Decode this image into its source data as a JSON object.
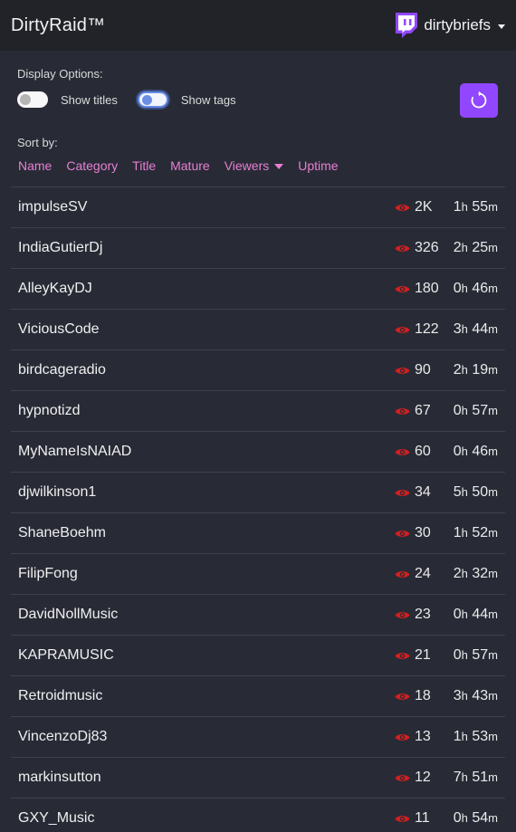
{
  "navbar": {
    "brand": "DirtyRaid™",
    "username": "dirtybriefs",
    "logo_icon": "twitch-logo-icon",
    "accent_color": "#9147ff"
  },
  "display_options": {
    "label": "Display Options:",
    "show_titles": {
      "label": "Show titles",
      "enabled": false
    },
    "show_tags": {
      "label": "Show tags",
      "enabled": true
    },
    "refresh_icon": "refresh-icon"
  },
  "sort": {
    "label": "Sort by:",
    "columns": [
      "Name",
      "Category",
      "Title",
      "Mature",
      "Viewers",
      "Uptime"
    ],
    "active": "Viewers",
    "direction": "descending",
    "link_color": "#e87fd3"
  },
  "streams": [
    {
      "name": "impulseSV",
      "viewers": "2K",
      "hours": "1",
      "minutes": "55"
    },
    {
      "name": "IndiaGutierDj",
      "viewers": "326",
      "hours": "2",
      "minutes": "25"
    },
    {
      "name": "AlleyKayDJ",
      "viewers": "180",
      "hours": "0",
      "minutes": "46"
    },
    {
      "name": "ViciousCode",
      "viewers": "122",
      "hours": "3",
      "minutes": "44"
    },
    {
      "name": "birdcageradio",
      "viewers": "90",
      "hours": "2",
      "minutes": "19"
    },
    {
      "name": "hypnotizd",
      "viewers": "67",
      "hours": "0",
      "minutes": "57"
    },
    {
      "name": "MyNameIsNAIAD",
      "viewers": "60",
      "hours": "0",
      "minutes": "46"
    },
    {
      "name": "djwilkinson1",
      "viewers": "34",
      "hours": "5",
      "minutes": "50"
    },
    {
      "name": "ShaneBoehm",
      "viewers": "30",
      "hours": "1",
      "minutes": "52"
    },
    {
      "name": "FilipFong",
      "viewers": "24",
      "hours": "2",
      "minutes": "32"
    },
    {
      "name": "DavidNollMusic",
      "viewers": "23",
      "hours": "0",
      "minutes": "44"
    },
    {
      "name": "KAPRAMUSIC",
      "viewers": "21",
      "hours": "0",
      "minutes": "57"
    },
    {
      "name": "Retroidmusic",
      "viewers": "18",
      "hours": "3",
      "minutes": "43"
    },
    {
      "name": "VincenzoDj83",
      "viewers": "13",
      "hours": "1",
      "minutes": "53"
    },
    {
      "name": "markinsutton",
      "viewers": "12",
      "hours": "7",
      "minutes": "51"
    },
    {
      "name": "GXY_Music",
      "viewers": "11",
      "hours": "0",
      "minutes": "54"
    }
  ],
  "units": {
    "hours": "h",
    "minutes": "m"
  },
  "viewer_icon": "eye-icon",
  "viewer_icon_color": "#d41e1e"
}
